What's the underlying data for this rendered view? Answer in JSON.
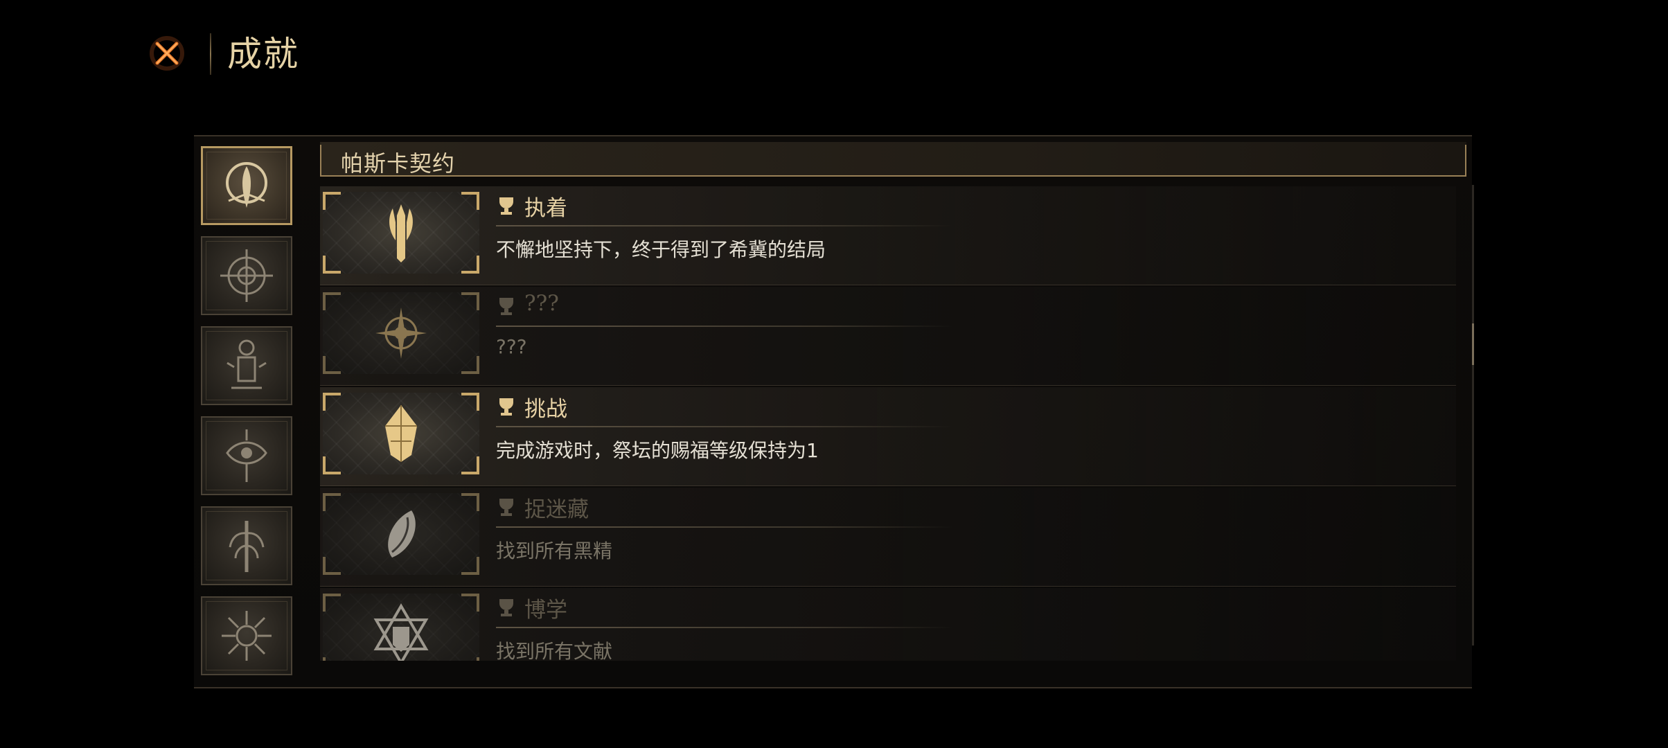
{
  "header": {
    "title": "成就"
  },
  "sidebar": {
    "tabs": [
      {
        "icon": "crescent-sigil-icon",
        "active": true
      },
      {
        "icon": "compass-sigil-icon",
        "active": false
      },
      {
        "icon": "lantern-sigil-icon",
        "active": false
      },
      {
        "icon": "eye-sigil-icon",
        "active": false
      },
      {
        "icon": "tree-sigil-icon",
        "active": false
      },
      {
        "icon": "starburst-sigil-icon",
        "active": false
      }
    ]
  },
  "section": {
    "title": "帕斯卡契约"
  },
  "achievements": [
    {
      "title": "执着",
      "description": "不懈地坚持下，终于得到了希冀的结局",
      "unlocked": true,
      "status_icon": "sparkle-icon"
    },
    {
      "title": "???",
      "description": "???",
      "unlocked": false,
      "status_icon": "sparkle-icon"
    },
    {
      "title": "挑战",
      "description": "完成游戏时，祭坛的赐福等级保持为1",
      "unlocked": true,
      "status_icon": "diamond-eye-icon"
    },
    {
      "title": "捉迷藏",
      "description": "找到所有黑精",
      "unlocked": false,
      "status_icon": "sparkle-icon"
    },
    {
      "title": "博学",
      "description": "找到所有文献",
      "unlocked": false,
      "status_icon": "sparkle-icon"
    }
  ],
  "colors": {
    "gold": "#c9a86a",
    "title_text": "#e7d2a5",
    "background": "#000000"
  }
}
